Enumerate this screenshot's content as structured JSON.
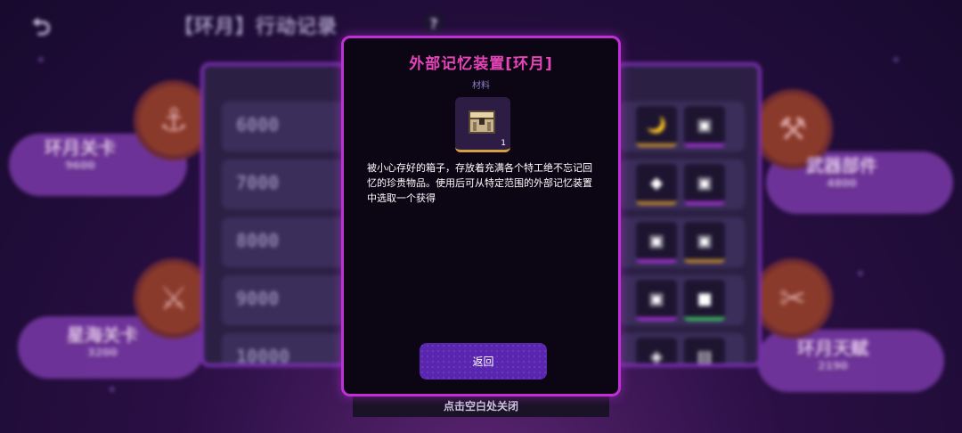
{
  "header": {
    "title": "【环月】行动记录",
    "help_label": "?"
  },
  "side": {
    "left_top": {
      "name": "环月关卡",
      "value": "9600"
    },
    "left_bottom": {
      "name": "星海关卡",
      "value": "3200"
    },
    "right_top": {
      "name": "武器部件",
      "value": "4800"
    },
    "right_bottom": {
      "name": "环月天赋",
      "value": "2190"
    }
  },
  "milestones": [
    "6000",
    "7000",
    "8000",
    "9000",
    "10000"
  ],
  "modal": {
    "title": "外部记忆装置[环月]",
    "category": "材料",
    "item_count": "1",
    "description": "被小心存好的箱子，存放着充满各个特工绝不忘记回忆的珍贵物品。使用后可从特定范围的外部记忆装置中选取一个获得",
    "return_label": "返回"
  },
  "close_hint": "点击空白处关闭",
  "colors": {
    "accent": "#c02fd6",
    "title": "#e545b8",
    "button": "#5a26b0"
  }
}
